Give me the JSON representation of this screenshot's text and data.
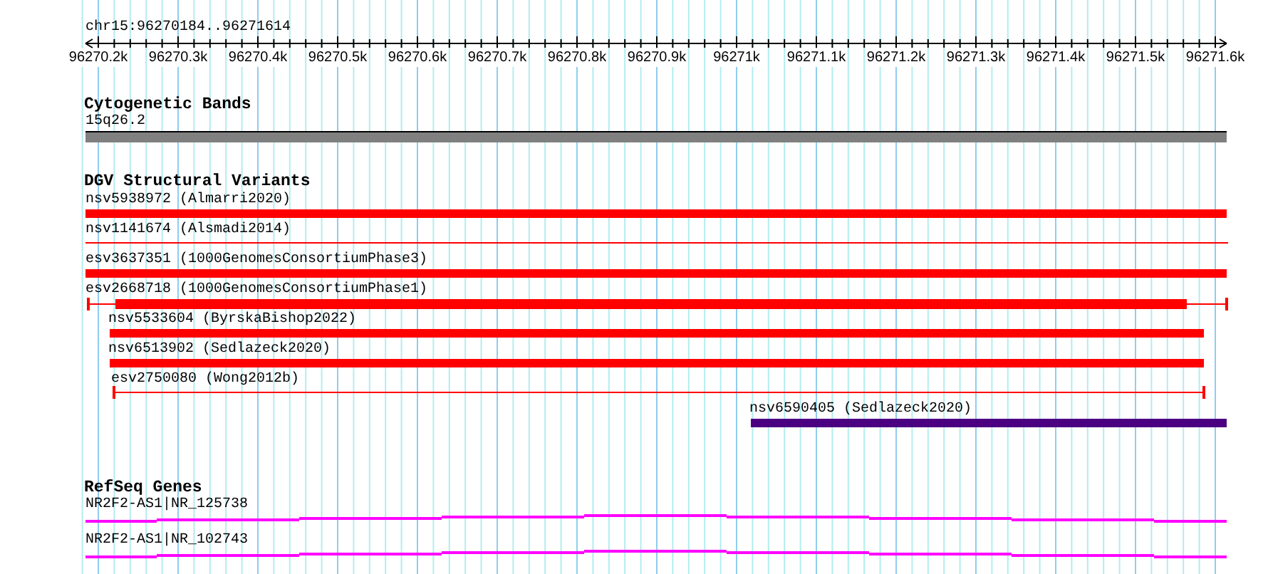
{
  "location": "chr15:96270184..96271614",
  "ruler": {
    "labels": [
      "96270.2k",
      "96270.3k",
      "96270.4k",
      "96270.5k",
      "96270.6k",
      "96270.7k",
      "96270.8k",
      "96270.9k",
      "96271k",
      "96271.1k",
      "96271.2k",
      "96271.3k",
      "96271.4k",
      "96271.5k",
      "96271.6k"
    ]
  },
  "tracks": [
    {
      "kind": "cytoband",
      "title": "Cytogenetic Bands",
      "features": [
        {
          "label": "15q26.2",
          "color": "#808080"
        }
      ]
    },
    {
      "kind": "variants",
      "title": "DGV Structural Variants",
      "features": [
        {
          "label": "nsv5938972 (Almarri2020)",
          "kind": "thick",
          "color": "#ff0000"
        },
        {
          "label": "nsv1141674 (Alsmadi2014)",
          "kind": "thin",
          "color": "#ff0000"
        },
        {
          "label": "esv3637351 (1000GenomesConsortiumPhase3)",
          "kind": "thick",
          "color": "#ff0000"
        },
        {
          "label": "esv2668718 (1000GenomesConsortiumPhase1)",
          "kind": "partial",
          "color": "#ff0000"
        },
        {
          "label": "nsv5533604 (ByrskaBishop2022)",
          "kind": "thick",
          "color": "#ff0000"
        },
        {
          "label": "nsv6513902 (Sedlazeck2020)",
          "kind": "thick",
          "color": "#ff0000"
        },
        {
          "label": "esv2750080 (Wong2012b)",
          "kind": "thin",
          "color": "#ff0000"
        },
        {
          "label": "nsv6590405 (Sedlazeck2020)",
          "kind": "thick",
          "color": "#4b0082"
        }
      ]
    },
    {
      "kind": "genes",
      "title": "RefSeq Genes",
      "features": [
        {
          "label": "NR2F2-AS1|NR_125738",
          "color": "#ff00ff"
        },
        {
          "label": "NR2F2-AS1|NR_102743",
          "color": "#ff00ff"
        }
      ]
    }
  ]
}
